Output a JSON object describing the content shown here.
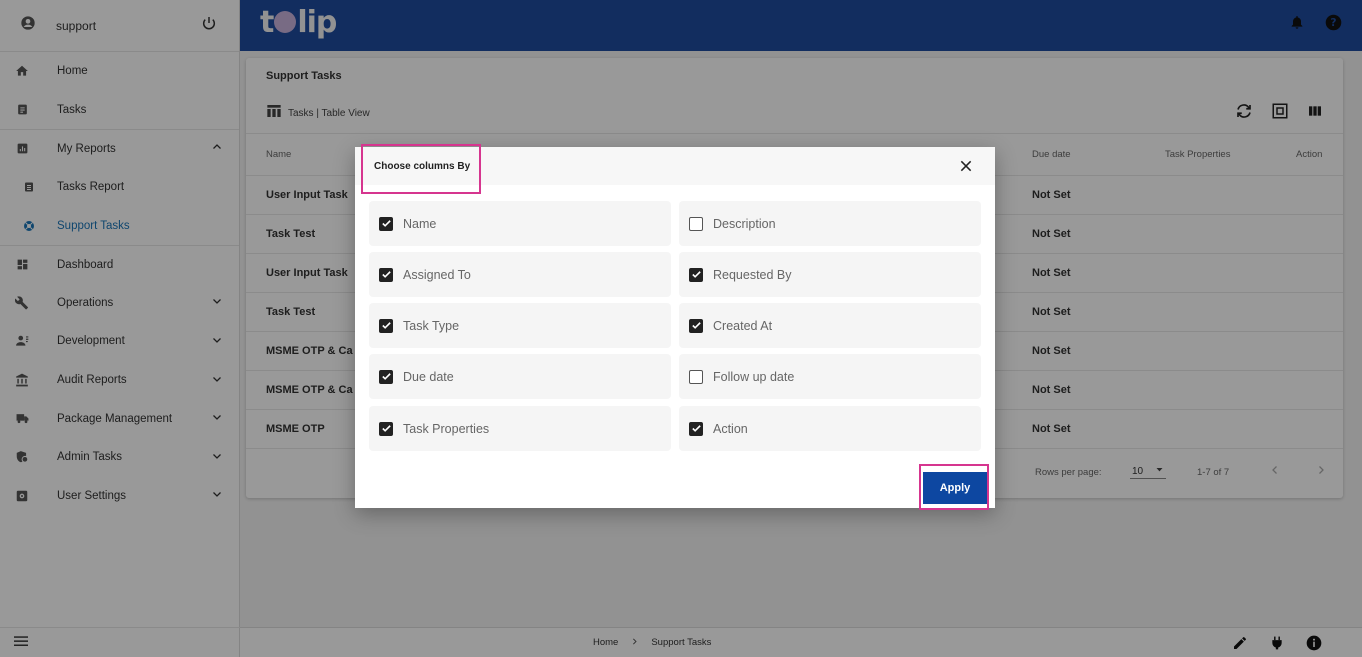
{
  "user": {
    "name": "support"
  },
  "sidebar": {
    "items": [
      {
        "label": "Home",
        "icon": "home-icon"
      },
      {
        "label": "Tasks",
        "icon": "assignment-icon"
      },
      {
        "label": "My Reports",
        "icon": "report-icon"
      },
      {
        "label": "Tasks Report",
        "icon": "list-icon"
      },
      {
        "label": "Support Tasks",
        "icon": "support-icon"
      },
      {
        "label": "Dashboard",
        "icon": "dashboard-icon"
      },
      {
        "label": "Operations",
        "icon": "wrench-icon"
      },
      {
        "label": "Development",
        "icon": "developer-icon"
      },
      {
        "label": "Audit Reports",
        "icon": "bank-icon"
      },
      {
        "label": "Package Management",
        "icon": "truck-icon"
      },
      {
        "label": "Admin Tasks",
        "icon": "admin-icon"
      },
      {
        "label": "User Settings",
        "icon": "settings-icon"
      }
    ]
  },
  "header": {
    "logo_text": "tulip"
  },
  "page": {
    "title": "Support Tasks",
    "view_label": "Tasks | Table View",
    "columns": {
      "name": "Name",
      "due_date": "Due date",
      "task_properties": "Task Properties",
      "action": "Action"
    },
    "rows": [
      {
        "name": "User Input Task",
        "due": "Not Set"
      },
      {
        "name": "Task Test",
        "due": "Not Set"
      },
      {
        "name": "User Input Task",
        "due": "Not Set"
      },
      {
        "name": "Task Test",
        "due": "Not Set"
      },
      {
        "name": "MSME OTP & Ca",
        "due": "Not Set"
      },
      {
        "name": "MSME OTP & Ca",
        "due": "Not Set"
      },
      {
        "name": "MSME OTP",
        "due": "Not Set"
      }
    ],
    "pagination": {
      "rows_label": "Rows per page:",
      "rows_value": "10",
      "range": "1-7 of 7"
    }
  },
  "breadcrumb": {
    "home": "Home",
    "current": "Support Tasks"
  },
  "modal": {
    "title": "Choose columns By",
    "options": [
      {
        "label": "Name",
        "checked": true
      },
      {
        "label": "Description",
        "checked": false
      },
      {
        "label": "Assigned To",
        "checked": true
      },
      {
        "label": "Requested By",
        "checked": true
      },
      {
        "label": "Task Type",
        "checked": true
      },
      {
        "label": "Created At",
        "checked": true
      },
      {
        "label": "Due date",
        "checked": true
      },
      {
        "label": "Follow up date",
        "checked": false
      },
      {
        "label": "Task Properties",
        "checked": true
      },
      {
        "label": "Action",
        "checked": true
      }
    ],
    "apply_label": "Apply"
  },
  "colors": {
    "header": "#1e4b9e",
    "accent": "#1a75b8",
    "apply": "#0d47a1",
    "highlight": "#d6358f"
  }
}
